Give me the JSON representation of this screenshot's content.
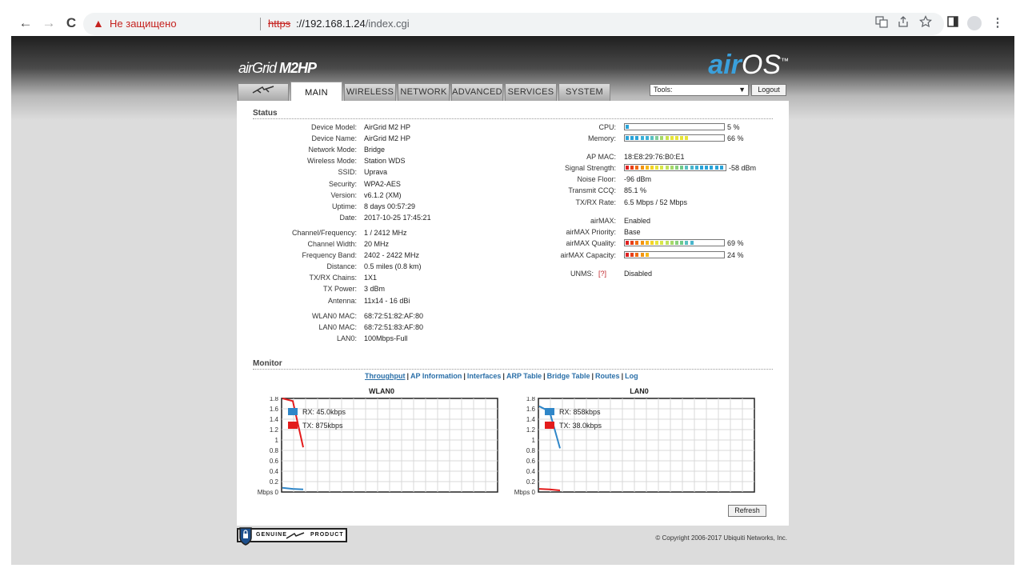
{
  "browser": {
    "back_icon": "←",
    "forward_icon": "→",
    "reload_icon": "C",
    "warning_icon": "▲",
    "security_label": "Не защищено",
    "protocol": "https",
    "url_host": "://192.168.1.24",
    "url_path": "/index.cgi"
  },
  "header": {
    "brand_prefix": "air",
    "brand_product": "Grid",
    "brand_model": "M2HP",
    "os_prefix": "air",
    "os_suffix": "OS",
    "os_tm": "™"
  },
  "tabs": [
    {
      "label": "",
      "active": false
    },
    {
      "label": "MAIN",
      "active": true
    },
    {
      "label": "WIRELESS",
      "active": false
    },
    {
      "label": "NETWORK",
      "active": false
    },
    {
      "label": "ADVANCED",
      "active": false
    },
    {
      "label": "SERVICES",
      "active": false
    },
    {
      "label": "SYSTEM",
      "active": false
    }
  ],
  "tools": {
    "selected": "Tools:",
    "logout_label": "Logout"
  },
  "status": {
    "title": "Status",
    "left": [
      {
        "label": "Device Model:",
        "value": "AirGrid M2 HP"
      },
      {
        "label": "Device Name:",
        "value": "AirGrid M2 HP"
      },
      {
        "label": "Network Mode:",
        "value": "Bridge"
      },
      {
        "label": "Wireless Mode:",
        "value": "Station WDS"
      },
      {
        "label": "SSID:",
        "value": "Uprava"
      },
      {
        "label": "Security:",
        "value": "WPA2-AES"
      },
      {
        "label": "Version:",
        "value": "v6.1.2 (XM)"
      },
      {
        "label": "Uptime:",
        "value": "8 days 00:57:29"
      },
      {
        "label": "Date:",
        "value": "2017-10-25 17:45:21"
      },
      {
        "label": "Channel/Frequency:",
        "value": "1 / 2412 MHz"
      },
      {
        "label": "Channel Width:",
        "value": "20 MHz"
      },
      {
        "label": "Frequency Band:",
        "value": "2402 - 2422 MHz"
      },
      {
        "label": "Distance:",
        "value": "0.5 miles (0.8 km)"
      },
      {
        "label": "TX/RX Chains:",
        "value": "1X1"
      },
      {
        "label": "TX Power:",
        "value": "3 dBm"
      },
      {
        "label": "Antenna:",
        "value": "11x14 - 16 dBi"
      },
      {
        "label": "WLAN0 MAC:",
        "value": "68:72:51:82:AF:80"
      },
      {
        "label": "LAN0 MAC:",
        "value": "68:72:51:83:AF:80"
      },
      {
        "label": "LAN0:",
        "value": "100Mbps-Full"
      }
    ],
    "right": [
      {
        "label": "CPU:",
        "value": "5 %",
        "level": 0.05
      },
      {
        "label": "Memory:",
        "value": "66 %",
        "level": 0.66
      },
      {
        "label": "AP MAC:",
        "value": "18:E8:29:76:B0:E1"
      },
      {
        "label": "Signal Strength:",
        "value": "-58 dBm",
        "level": 1.0
      },
      {
        "label": "Noise Floor:",
        "value": "-96 dBm"
      },
      {
        "label": "Transmit CCQ:",
        "value": "85.1 %"
      },
      {
        "label": "TX/RX Rate:",
        "value": "6.5 Mbps / 52 Mbps"
      },
      {
        "label": "airMAX:",
        "value": "Enabled"
      },
      {
        "label": "airMAX Priority:",
        "value": "Base"
      },
      {
        "label": "airMAX Quality:",
        "value": "69 %",
        "level": 0.69
      },
      {
        "label": "airMAX Capacity:",
        "value": "24 %",
        "level": 0.24
      },
      {
        "label": "UNMS:",
        "help": "[?]",
        "value": "Disabled"
      }
    ]
  },
  "monitor": {
    "title": "Monitor",
    "links": [
      {
        "label": "Throughput",
        "current": true
      },
      {
        "label": "AP Information",
        "current": false
      },
      {
        "label": "Interfaces",
        "current": false
      },
      {
        "label": "ARP Table",
        "current": false
      },
      {
        "label": "Bridge Table",
        "current": false
      },
      {
        "label": "Routes",
        "current": false
      },
      {
        "label": "Log",
        "current": false
      }
    ],
    "refresh_label": "Refresh"
  },
  "chart_data": [
    {
      "type": "line",
      "title": "WLAN0",
      "y_ticks": [
        "1.8",
        "1.6",
        "1.4",
        "1.2",
        "1",
        "0.8",
        "0.6",
        "0.4",
        "0.2",
        "Mbps 0"
      ],
      "ylim": [
        0,
        1.8
      ],
      "series": [
        {
          "name": "RX: 45.0kbps",
          "color": "#2f86c8",
          "x": [
            0,
            1,
            2
          ],
          "y": [
            0.08,
            0.06,
            0.05
          ]
        },
        {
          "name": "TX: 875kbps",
          "color": "#e31b1b",
          "x": [
            0,
            1,
            2
          ],
          "y": [
            1.8,
            1.75,
            0.86
          ]
        }
      ]
    },
    {
      "type": "line",
      "title": "LAN0",
      "y_ticks": [
        "1.8",
        "1.6",
        "1.4",
        "1.2",
        "1",
        "0.8",
        "0.6",
        "0.4",
        "0.2",
        "Mbps 0"
      ],
      "ylim": [
        0,
        1.8
      ],
      "series": [
        {
          "name": "RX: 858kbps",
          "color": "#2f86c8",
          "x": [
            0,
            1,
            2
          ],
          "y": [
            1.65,
            1.55,
            0.84
          ]
        },
        {
          "name": "TX: 38.0kbps",
          "color": "#e31b1b",
          "x": [
            0,
            1,
            2
          ],
          "y": [
            0.06,
            0.05,
            0.03
          ]
        }
      ]
    }
  ],
  "footer": {
    "genuine_left": "GENUINE",
    "genuine_right": "PRODUCT",
    "copyright": "© Copyright 2006-2017 Ubiquiti Networks, Inc."
  }
}
